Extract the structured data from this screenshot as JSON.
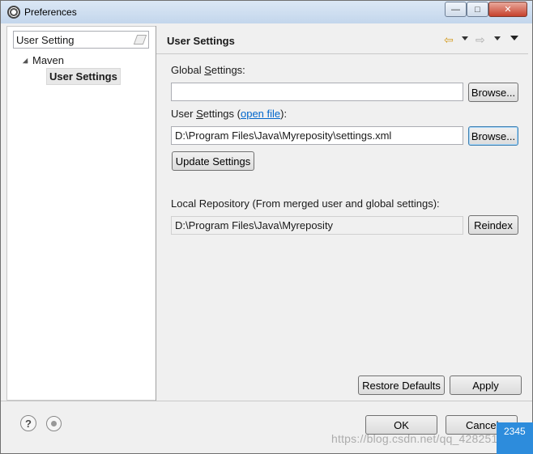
{
  "window": {
    "title": "Preferences",
    "controls": {
      "minimize": "—",
      "maximize": "□",
      "close": "✕"
    }
  },
  "sidebar": {
    "filter_value": "User Setting",
    "tree": {
      "maven": "Maven",
      "user_settings": "User Settings"
    }
  },
  "page": {
    "title": "User Settings",
    "global_settings_label_pre": "Global ",
    "global_settings_label_u": "S",
    "global_settings_label_post": "ettings:",
    "global_settings_value": "",
    "user_settings_label_pre": "User ",
    "user_settings_label_u": "S",
    "user_settings_label_post": "ettings (",
    "open_file_link": "open file",
    "user_settings_label_end": "):",
    "user_settings_value": "D:\\Program Files\\Java\\Myreposity\\settings.xml",
    "browse_label": "Browse...",
    "update_settings_label": "Update Settings",
    "local_repo_label": "Local Repository (From merged user and global settings):",
    "local_repo_value": "D:\\Program Files\\Java\\Myreposity",
    "reindex_label": "Reindex",
    "restore_defaults_label": "Restore Defaults",
    "apply_label": "Apply"
  },
  "footer": {
    "ok_label": "OK",
    "cancel_label": "Cancel",
    "help_icon": "?"
  },
  "overlay": {
    "watermark": "https://blog.csdn.net/qq_42825101",
    "badge": "2345"
  }
}
